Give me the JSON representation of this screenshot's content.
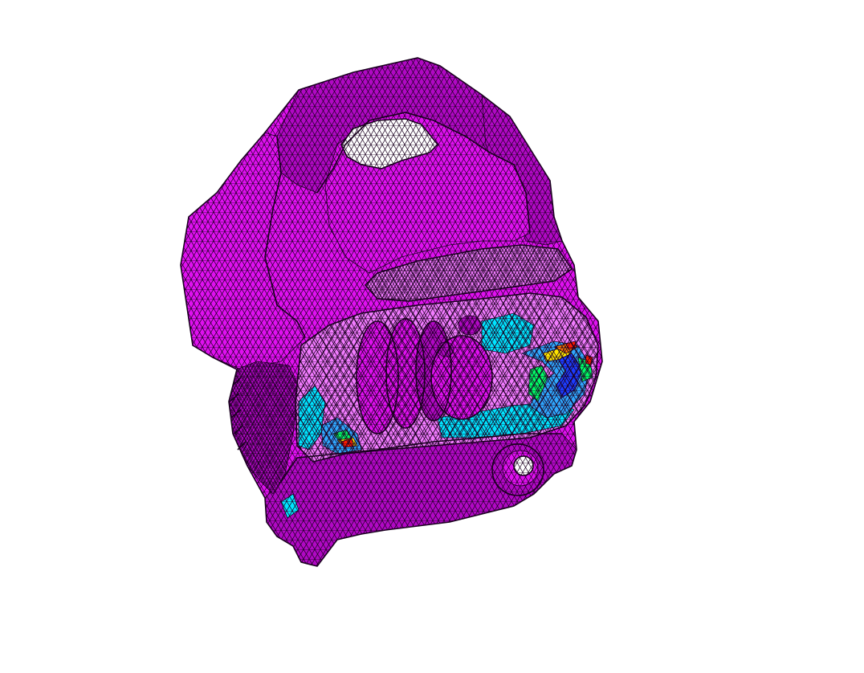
{
  "viewport": {
    "background_color": "#ffffff"
  },
  "model": {
    "subject": "engine-housing-fe-mesh",
    "base_color": "#e010f0",
    "shade_dark": "#b108c4",
    "shade_light": "#f27cff",
    "mesh_line_color": "#1a001f",
    "contour_colors": [
      "#00e5ff",
      "#2fa8ff",
      "#1b3cff",
      "#00ff66",
      "#ffe600",
      "#ff7a00",
      "#ff1a00"
    ],
    "hole_fill": "#ffffff"
  }
}
